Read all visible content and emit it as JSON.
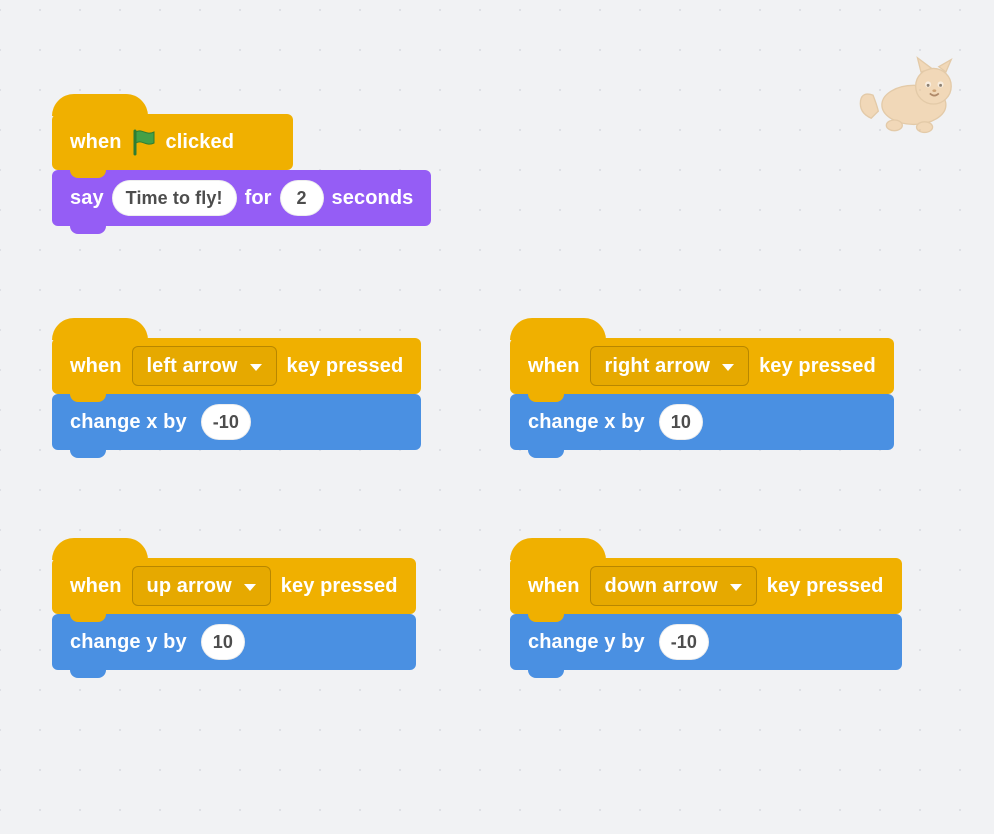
{
  "script1": {
    "hat_when": "when",
    "hat_clicked": "clicked",
    "say": "say",
    "say_text": "Time to fly!",
    "for": "for",
    "seconds_value": "2",
    "seconds": "seconds"
  },
  "keyblocks": {
    "when": "when",
    "key_pressed": "key pressed"
  },
  "left": {
    "dropdown": "left arrow",
    "action": "change x by",
    "value": "-10"
  },
  "right": {
    "dropdown": "right arrow",
    "action": "change x by",
    "value": "10"
  },
  "up": {
    "dropdown": "up arrow",
    "action": "change y by",
    "value": "10"
  },
  "down": {
    "dropdown": "down arrow",
    "action": "change y by",
    "value": "-10"
  },
  "colors": {
    "events": "#f0b000",
    "looks": "#955df5",
    "motion": "#4a90e2",
    "flag": "#3fa447"
  }
}
